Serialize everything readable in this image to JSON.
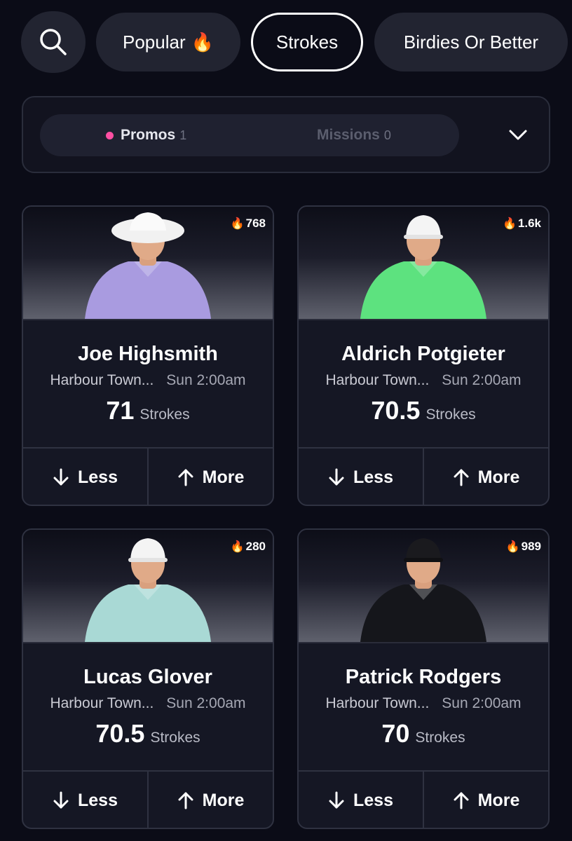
{
  "filters": {
    "search_icon": "search-icon",
    "chips": [
      {
        "label": "Popular",
        "icon": "fire-emoji",
        "glyph": "🔥"
      },
      {
        "label": "Strokes",
        "selected": true
      },
      {
        "label": "Birdies Or Better"
      }
    ]
  },
  "promo_panel": {
    "promos_label": "Promos",
    "promos_count": "1",
    "missions_label": "Missions",
    "missions_count": "0",
    "expand_icon": "chevron-down-icon"
  },
  "cards": [
    {
      "hot_count": "768",
      "name": "Joe Highsmith",
      "course": "Harbour Town...",
      "time": "Sun 2:00am",
      "line_value": "71",
      "line_unit": "Strokes",
      "less_label": "Less",
      "more_label": "More",
      "shirt_color": "#a99be0",
      "hat": "bucket-hat"
    },
    {
      "hot_count": "1.6k",
      "name": "Aldrich Potgieter",
      "course": "Harbour Town...",
      "time": "Sun 2:00am",
      "line_value": "70.5",
      "line_unit": "Strokes",
      "less_label": "Less",
      "more_label": "More",
      "shirt_color": "#5de27f",
      "hat": "cap-white"
    },
    {
      "hot_count": "280",
      "name": "Lucas Glover",
      "course": "Harbour Town...",
      "time": "Sun 2:00am",
      "line_value": "70.5",
      "line_unit": "Strokes",
      "less_label": "Less",
      "more_label": "More",
      "shirt_color": "#a9d9d5",
      "hat": "cap-white"
    },
    {
      "hot_count": "989",
      "name": "Patrick Rodgers",
      "course": "Harbour Town...",
      "time": "Sun 2:00am",
      "line_value": "70",
      "line_unit": "Strokes",
      "less_label": "Less",
      "more_label": "More",
      "shirt_color": "#15161b",
      "hat": "cap-black"
    }
  ],
  "colors": {
    "background": "#0b0c17",
    "card": "#151724",
    "accent_pink": "#ff4fa3"
  }
}
